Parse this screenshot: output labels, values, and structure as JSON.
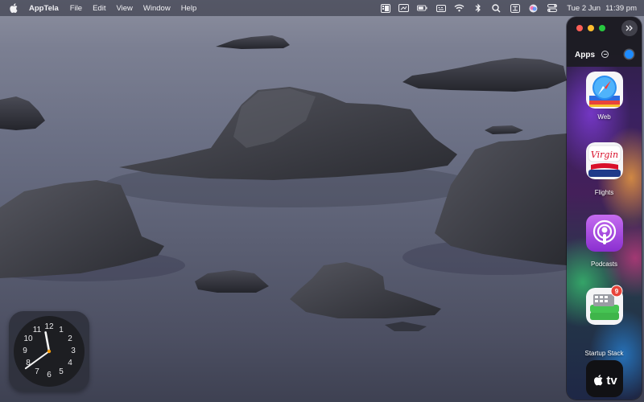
{
  "menubar": {
    "app_name": "AppTela",
    "menus": [
      "File",
      "Edit",
      "View",
      "Window",
      "Help"
    ],
    "date": "Tue 2 Jun",
    "time": "11:39 pm",
    "status_icons": [
      "stage-manager-icon",
      "display-icon",
      "battery-icon",
      "keyboard-icon",
      "wifi-icon",
      "bluetooth-icon",
      "search-icon",
      "input-source-icon",
      "siri-icon",
      "control-center-icon"
    ]
  },
  "clock": {
    "numbers": [
      "12",
      "1",
      "2",
      "3",
      "4",
      "5",
      "6",
      "7",
      "8",
      "9",
      "10",
      "11"
    ],
    "hour": 11,
    "minute": 39
  },
  "panel": {
    "title": "Apps",
    "apps": [
      {
        "label": "Web",
        "icon": "safari-icon"
      },
      {
        "label": "Flights",
        "icon": "virgin-flights-icon"
      },
      {
        "label": "Podcasts",
        "icon": "podcasts-icon"
      },
      {
        "label": "Startup Stack",
        "icon": "startup-stack-icon",
        "badge": "9"
      },
      {
        "label": "",
        "icon": "apple-tv-icon",
        "icon_text": "tv"
      }
    ]
  },
  "colors": {
    "accent_blue": "#1e8cff",
    "traffic_red": "#ff5f57",
    "traffic_yellow": "#febc2e",
    "traffic_green": "#28c840",
    "podcasts_purple": "#9b3ed8"
  }
}
